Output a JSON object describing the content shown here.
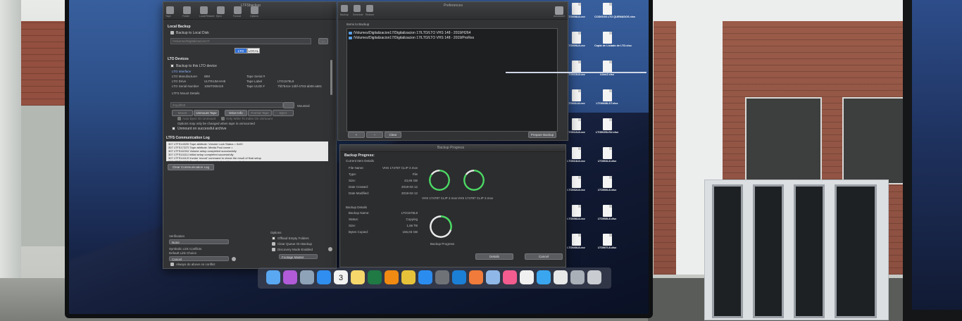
{
  "titles": {
    "backup_window": "LTFSbackup",
    "prefs_window": "Preferences",
    "progress_window": "Backup Progress"
  },
  "toolbar_left": [
    "Tape",
    "Folder",
    "Local Restore",
    "Eject",
    "Format",
    "Options"
  ],
  "toolbar_right": [
    "Backup",
    "Schedule",
    "Restore"
  ],
  "toolbar_right_end": "Advanced",
  "local_backup": {
    "section": "Local Backup",
    "checkbox": "Backup to Local Disk",
    "path_placeholder": "/Volumes/Digitalizacion17/",
    "browse": "..."
  },
  "segment": [
    "LTO",
    "LOCAL"
  ],
  "lto_devices": {
    "section": "LTO Devices",
    "checkbox": "Backup to this LTO device",
    "interface_label": "LTO Interface",
    "rows": [
      {
        "k1": "LTO Manufacturer",
        "v1": "IBM",
        "k2": "Tape Serial #",
        "v2": ""
      },
      {
        "k1": "LTO Drive",
        "v1": "ULTRIUM-HH8",
        "k2": "Tape Label",
        "v2": "LTO1578L8"
      },
      {
        "k1": "LTO Serial Number",
        "v1": "10WT005419",
        "k2": "Tape UUID #",
        "v2": "7fd7b4ce-13bf-4763-ab05-a68c"
      }
    ],
    "mount_details": "LTFS Mount Details",
    "mount_path": "/tmp/ltfs0",
    "mounted": "Mounted",
    "buttons": [
      "Mount",
      "Unmount Tape",
      "Drive Info",
      "Format Tape",
      "Eject"
    ],
    "opt1": "Auto Eject On Unmount",
    "opt2": "Only Write To Index On Unmount",
    "opt_note": "Options may only be changed when tape is unmounted",
    "unmount_archive": "Unmount on successful archive"
  },
  "comm_log": {
    "section": "LTFS Communication Log",
    "lines": [
      "307 LTFS14029I Tape attribute: Volume Lock Status = 0x00",
      "307 LTFS17227I Tape attribute: Media Pool name =",
      "307 LTFS11031I Volume setup completed successfully",
      "307 LTFS14111I Initial setup completed successfully",
      "307 LTFS14112I Invoke 'mount' command to check the result of final setup",
      "307 LTFS14113I Specified mount point is listed if succeeded"
    ],
    "clear_button": "Clear Communication Log"
  },
  "items_to_backup": {
    "label": "Items to Backup",
    "rows": [
      "/Volumes/Digitalizacion17/Digitalizacion 17/LTO/LTO VHS 148 - 2019/H264",
      "/Volumes/Digitalizacion17/Digitalizacion 17/LTO/LTO VHS 148 - 2019/ProRes"
    ],
    "btn_add": "+",
    "btn_remove": "−",
    "btn_clear": "Clear",
    "btn_prepare": "Prepare Backup"
  },
  "progress": {
    "title": "Backup Progress:",
    "current_item_label": "Current Item Details",
    "fields": [
      {
        "k": "File Name:",
        "v": "VHS 174787 CLIP 2.mov"
      },
      {
        "k": "Type:",
        "v": "File"
      },
      {
        "k": "Size:",
        "v": "43,66 GB"
      },
      {
        "k": "Date Created:",
        "v": "2019-02-12"
      },
      {
        "k": "Date Modified:",
        "v": "2019-02-12"
      }
    ],
    "ring_labels": [
      "VHS 174787 CLIP 2.mov",
      "VHS 174787 CLIP 2.mov"
    ],
    "backup_details_label": "Backup Details",
    "backup_fields": [
      {
        "k": "Backup Name:",
        "v": "LTO1578L8"
      },
      {
        "k": "Status:",
        "v": "Copying"
      },
      {
        "k": "Size:",
        "v": "1,66 TB"
      },
      {
        "k": "Bytes Copied:",
        "v": "155,03 GB"
      }
    ],
    "backup_ring_label": "Backup Progress",
    "details_button": "Details",
    "cancel_button": "Cancel",
    "ring_fraction_1": 0.85,
    "ring_fraction_2": 0.85,
    "ring_fraction_3": 0.3
  },
  "settings": {
    "verification_label": "Verification",
    "verification_value": "None",
    "symlink_label": "Symbolic Link Conflicts",
    "default_link_label": "Default Link Choice",
    "default_link_value": "Cancel",
    "always_label": "Always do above on conflict",
    "options_label": "Options",
    "opt_offload": "Offload Empty Folders",
    "opt_clear_queue": "Clear Queue On Backup",
    "opt_discovery": "Discovery Mode Enabled",
    "mode_value": "Footage Master"
  },
  "desktop_files": [
    {
      "name": "LTO008L8.csv",
      "type": "csv"
    },
    {
      "name": "CODIGOS LTO QUEMADOS.xlsx",
      "type": "xlsx"
    },
    {
      "name": "LTO009L8.csv",
      "type": "csv"
    },
    {
      "name": "Copia de Listado de LTO.xlsx",
      "type": "xlsx"
    },
    {
      "name": "LTO010L8.csv",
      "type": "csv"
    },
    {
      "name": "Libro2.xlsx",
      "type": "xlsx"
    },
    {
      "name": "LTO011L8.csv",
      "type": "csv"
    },
    {
      "name": "LTO0028LST.xlsx",
      "type": "xlsx"
    },
    {
      "name": "LTO012L8.csv",
      "type": "csv"
    },
    {
      "name": "LTO0025LGU.xlsx",
      "type": "xlsx"
    },
    {
      "name": "LTO013L8.csv",
      "type": "csv"
    },
    {
      "name": "LTO004L8.xlsx",
      "type": "xlsx"
    },
    {
      "name": "LTO032L8.csv",
      "type": "csv"
    },
    {
      "name": "LTO006L8.xlsx",
      "type": "xlsx"
    },
    {
      "name": "LTO036L8.csv",
      "type": "csv"
    },
    {
      "name": "LTO008L8.xlsx",
      "type": "xlsx"
    },
    {
      "name": "LTO040L8.csv",
      "type": "csv"
    },
    {
      "name": "LTO007L8.xlsx",
      "type": "xlsx"
    }
  ],
  "dock": {
    "calendar_day": "3",
    "icons": [
      "finder-icon",
      "siri-icon",
      "launchpad-icon",
      "safari-icon",
      "calendar-icon",
      "notes-icon",
      "excel-icon",
      "vlc-icon",
      "chrome-icon",
      "appstore-icon",
      "system-preferences-icon",
      "edge-icon",
      "swift-icon",
      "preview-icon",
      "music-icon",
      "photos-icon",
      "quicktime-icon",
      "document-icon",
      "screenshot-icon",
      "trash-icon"
    ]
  },
  "colors": {
    "accent_green": "#4cd964",
    "selection_blue": "#2f6fd6"
  }
}
